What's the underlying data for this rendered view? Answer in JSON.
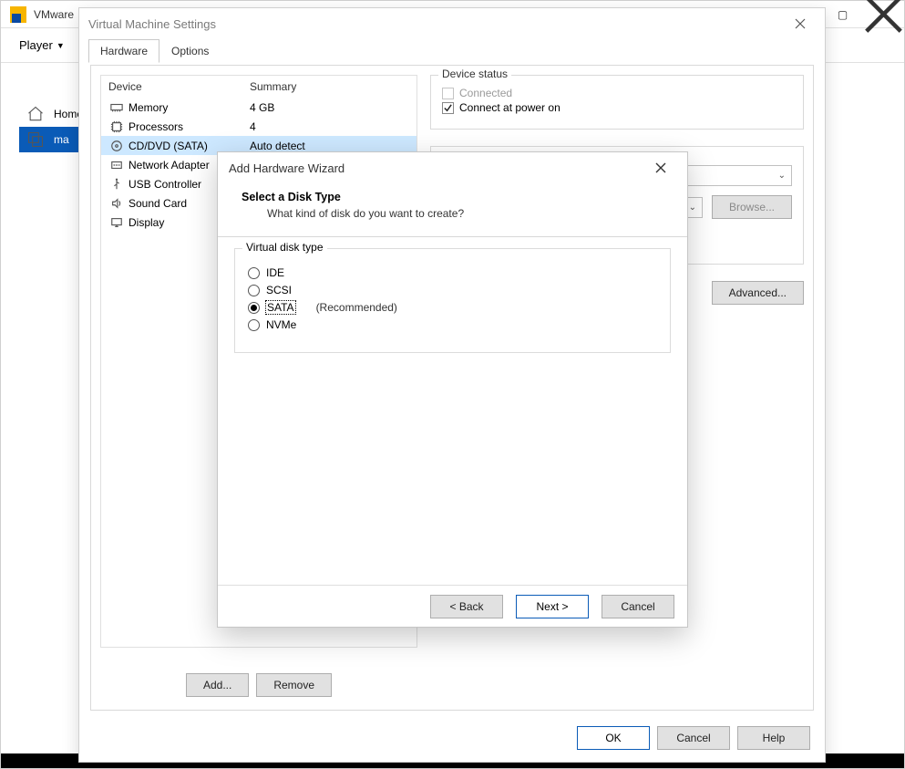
{
  "app": {
    "brand": "VMware",
    "player_menu": "Player"
  },
  "sidebar": {
    "items": [
      {
        "label": "Home",
        "icon": "home"
      },
      {
        "label": "ma",
        "icon": "vm"
      }
    ]
  },
  "settings": {
    "title": "Virtual Machine Settings",
    "tabs": {
      "hardware": "Hardware",
      "options": "Options"
    },
    "columns": {
      "device": "Device",
      "summary": "Summary"
    },
    "devices": [
      {
        "name": "Memory",
        "summary": "4 GB",
        "icon": "memory"
      },
      {
        "name": "Processors",
        "summary": "4",
        "icon": "cpu"
      },
      {
        "name": "CD/DVD (SATA)",
        "summary": "Auto detect",
        "icon": "cd",
        "selected": true
      },
      {
        "name": "Network Adapter",
        "summary": "",
        "icon": "net"
      },
      {
        "name": "USB Controller",
        "summary": "",
        "icon": "usb"
      },
      {
        "name": "Sound Card",
        "summary": "",
        "icon": "sound"
      },
      {
        "name": "Display",
        "summary": "",
        "icon": "display"
      }
    ],
    "buttons": {
      "add": "Add...",
      "remove": "Remove"
    },
    "status": {
      "legend": "Device status",
      "connected": "Connected",
      "power_on": "Connect at power on"
    },
    "right": {
      "browse": "Browse...",
      "advanced": "Advanced..."
    },
    "footer": {
      "ok": "OK",
      "cancel": "Cancel",
      "help": "Help"
    }
  },
  "wizard": {
    "title": "Add Hardware Wizard",
    "heading": "Select a Disk Type",
    "sub": "What kind of disk do you want to create?",
    "group_legend": "Virtual disk type",
    "options": {
      "ide": "IDE",
      "scsi": "SCSI",
      "sata": "SATA",
      "nvme": "NVMe",
      "recommended": "(Recommended)"
    },
    "buttons": {
      "back": "< Back",
      "next": "Next >",
      "cancel": "Cancel"
    }
  }
}
